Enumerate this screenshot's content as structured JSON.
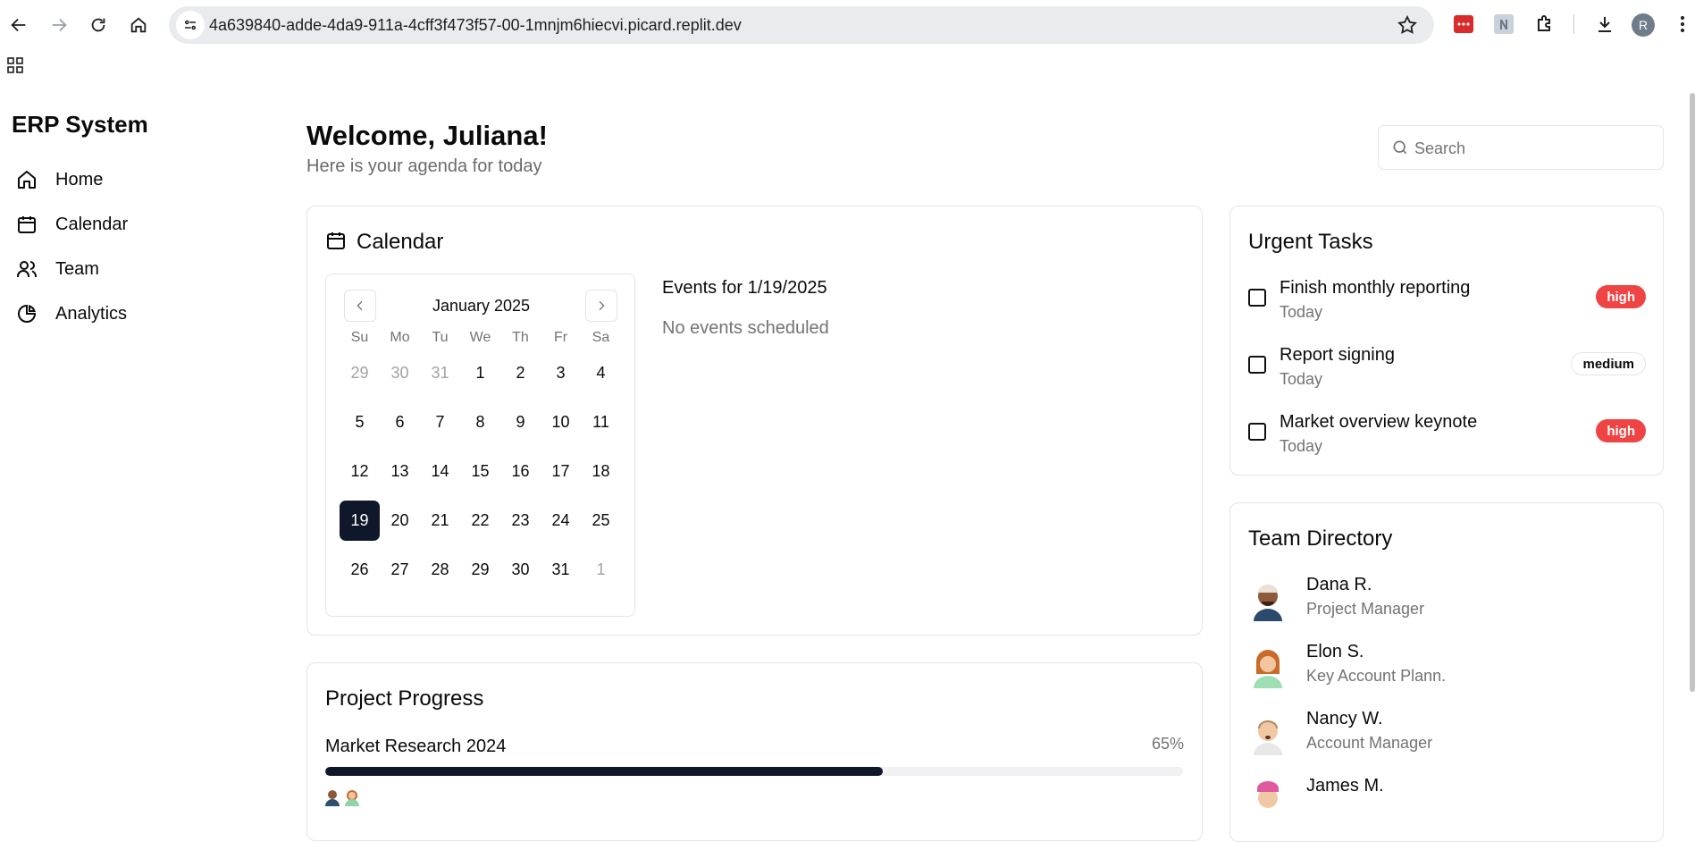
{
  "browser": {
    "url": "4a639840-adde-4da9-911a-4cff3f473f57-00-1mnjm6hiecvi.picard.replit.dev",
    "profile_initial": "R"
  },
  "sidebar": {
    "brand": "ERP System",
    "items": [
      {
        "label": "Home",
        "icon": "home-icon"
      },
      {
        "label": "Calendar",
        "icon": "calendar-icon"
      },
      {
        "label": "Team",
        "icon": "users-icon"
      },
      {
        "label": "Analytics",
        "icon": "pie-chart-icon"
      }
    ]
  },
  "header": {
    "welcome": "Welcome, Juliana!",
    "subtitle": "Here is your agenda for today",
    "search_placeholder": "Search"
  },
  "calendar": {
    "title": "Calendar",
    "month_label": "January 2025",
    "weekdays": [
      "Su",
      "Mo",
      "Tu",
      "We",
      "Th",
      "Fr",
      "Sa"
    ],
    "weeks": [
      [
        {
          "d": "29",
          "muted": true
        },
        {
          "d": "30",
          "muted": true
        },
        {
          "d": "31",
          "muted": true
        },
        {
          "d": "1"
        },
        {
          "d": "2"
        },
        {
          "d": "3"
        },
        {
          "d": "4"
        }
      ],
      [
        {
          "d": "5"
        },
        {
          "d": "6"
        },
        {
          "d": "7"
        },
        {
          "d": "8"
        },
        {
          "d": "9"
        },
        {
          "d": "10"
        },
        {
          "d": "11"
        }
      ],
      [
        {
          "d": "12"
        },
        {
          "d": "13"
        },
        {
          "d": "14"
        },
        {
          "d": "15"
        },
        {
          "d": "16"
        },
        {
          "d": "17"
        },
        {
          "d": "18"
        }
      ],
      [
        {
          "d": "19",
          "selected": true
        },
        {
          "d": "20"
        },
        {
          "d": "21"
        },
        {
          "d": "22"
        },
        {
          "d": "23"
        },
        {
          "d": "24"
        },
        {
          "d": "25"
        }
      ],
      [
        {
          "d": "26"
        },
        {
          "d": "27"
        },
        {
          "d": "28"
        },
        {
          "d": "29"
        },
        {
          "d": "30"
        },
        {
          "d": "31"
        },
        {
          "d": "1",
          "muted": true
        }
      ]
    ],
    "events_title": "Events for 1/19/2025",
    "events_empty": "No events scheduled"
  },
  "tasks": {
    "title": "Urgent Tasks",
    "items": [
      {
        "name": "Finish monthly reporting",
        "due": "Today",
        "priority": "high"
      },
      {
        "name": "Report signing",
        "due": "Today",
        "priority": "medium"
      },
      {
        "name": "Market overview keynote",
        "due": "Today",
        "priority": "high"
      }
    ]
  },
  "team": {
    "title": "Team Directory",
    "members": [
      {
        "name": "Dana R.",
        "role": "Project Manager"
      },
      {
        "name": "Elon S.",
        "role": "Key Account Plann."
      },
      {
        "name": "Nancy W.",
        "role": "Account Manager"
      },
      {
        "name": "James M.",
        "role": ""
      }
    ]
  },
  "progress": {
    "title": "Project Progress",
    "projects": [
      {
        "name": "Market Research 2024",
        "percent_label": "65%",
        "percent": 65
      }
    ]
  },
  "colors": {
    "accent_dark": "#0f172a",
    "priority_high": "#ef4444",
    "muted_text": "#737373"
  }
}
